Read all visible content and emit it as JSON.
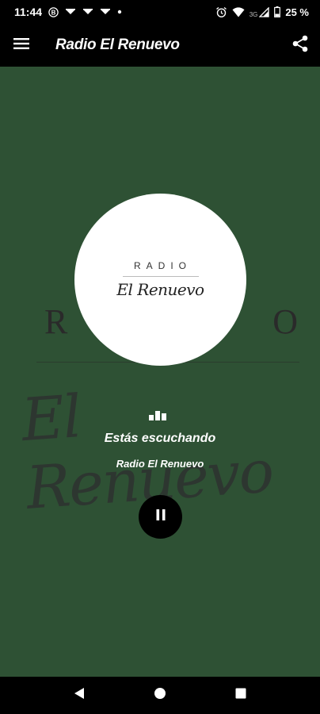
{
  "status_bar": {
    "time": "11:44",
    "network_type": "3G",
    "battery": "25 %"
  },
  "app_bar": {
    "title": "Radio El Renuevo",
    "menu_icon": "hamburger-menu-icon",
    "share_icon": "share-icon"
  },
  "background_logo": {
    "top_text": "R A D I O",
    "script_text": "El Renuevo"
  },
  "logo": {
    "top_text": "RADIO",
    "script_text": "El Renuevo"
  },
  "player": {
    "status_label": "Estás escuchando",
    "station_name": "Radio El Renuevo",
    "play_state": "playing",
    "control_icon": "pause-icon"
  },
  "colors": {
    "background": "#2e5134",
    "bars": "#000000",
    "text": "#ffffff",
    "logo_circle": "#ffffff"
  }
}
